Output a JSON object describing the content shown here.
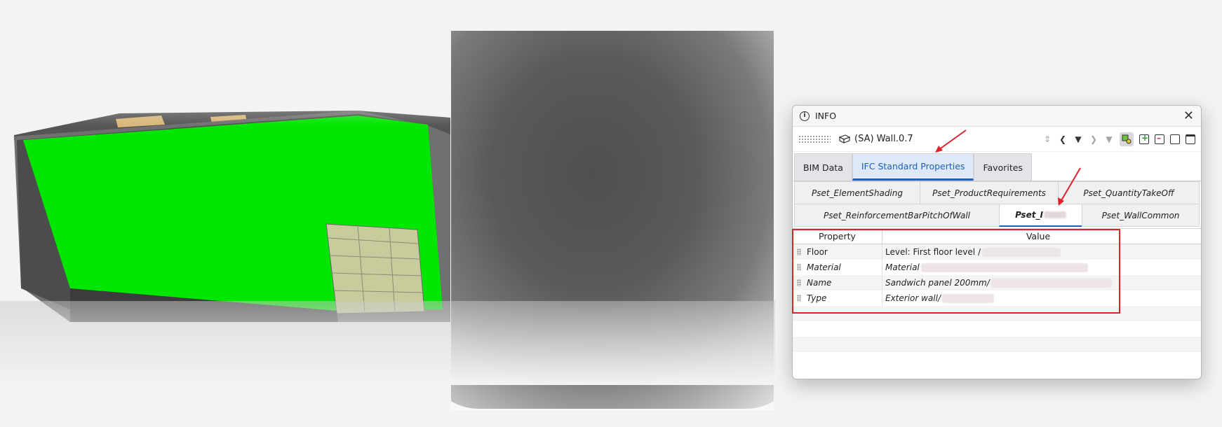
{
  "window": {
    "title": "INFO",
    "close_glyph": "✕",
    "info_glyph": "i"
  },
  "toolbar": {
    "element_name": "(SA) Wall.0.7",
    "icons": [
      "sort-updown-icon",
      "prev-icon",
      "dropdown-icon",
      "next-icon",
      "dropdown-dim-icon",
      "select-filter-icon",
      "add-favorite-icon",
      "remove-favorite-icon",
      "clear-icon",
      "window-icon"
    ]
  },
  "tabs": [
    {
      "label": "BIM Data"
    },
    {
      "label": "IFC Standard Properties"
    },
    {
      "label": "Favorites"
    }
  ],
  "psets": {
    "row1": [
      "Pset_ElementShading",
      "Pset_ProductRequirements",
      "Pset_QuantityTakeOff"
    ],
    "row2": [
      "Pset_ReinforcementBarPitchOfWall",
      "Pset_I",
      "Pset_WallCommon"
    ]
  },
  "table": {
    "headers": {
      "property": "Property",
      "value": "Value"
    },
    "rows": [
      {
        "property": "Floor",
        "value": "Level: First floor level / "
      },
      {
        "property": "Material",
        "value": "Material "
      },
      {
        "property": "Name",
        "value": "Sandwich panel 200mm/"
      },
      {
        "property": "Type",
        "value": "Exterior wall/"
      }
    ]
  },
  "colors": {
    "wall_green": "#00e600",
    "accent_blue": "#1d5fbf",
    "annotation_red": "#e0212a"
  }
}
